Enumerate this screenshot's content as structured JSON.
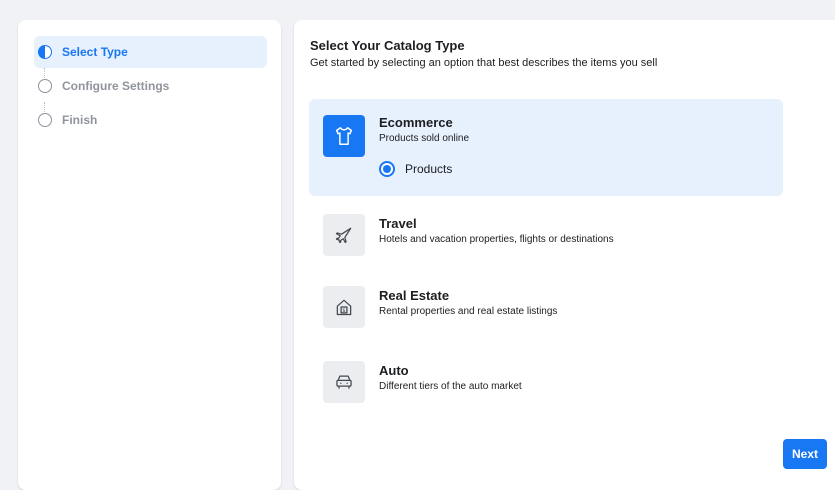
{
  "sidebar": {
    "steps": [
      {
        "label": "Select Type",
        "state": "active"
      },
      {
        "label": "Configure Settings",
        "state": "pending"
      },
      {
        "label": "Finish",
        "state": "pending"
      }
    ]
  },
  "main": {
    "title": "Select Your Catalog Type",
    "subtitle": "Get started by selecting an option that best describes the items you sell",
    "options": [
      {
        "title": "Ecommerce",
        "description": "Products sold online",
        "icon": "tshirt-icon",
        "selected": true,
        "sub_option": {
          "label": "Products",
          "checked": true
        }
      },
      {
        "title": "Travel",
        "description": "Hotels and vacation properties, flights or destinations",
        "icon": "airplane-icon",
        "selected": false
      },
      {
        "title": "Real Estate",
        "description": "Rental properties and real estate listings",
        "icon": "house-dollar-icon",
        "selected": false
      },
      {
        "title": "Auto",
        "description": "Different tiers of the auto market",
        "icon": "car-icon",
        "selected": false
      }
    ]
  },
  "footer": {
    "next_label": "Next"
  },
  "colors": {
    "accent": "#1877f2",
    "selected_bg": "#e7f0fd",
    "page_bg": "#f0f2f5",
    "icon_bg": "#ebedf0"
  }
}
